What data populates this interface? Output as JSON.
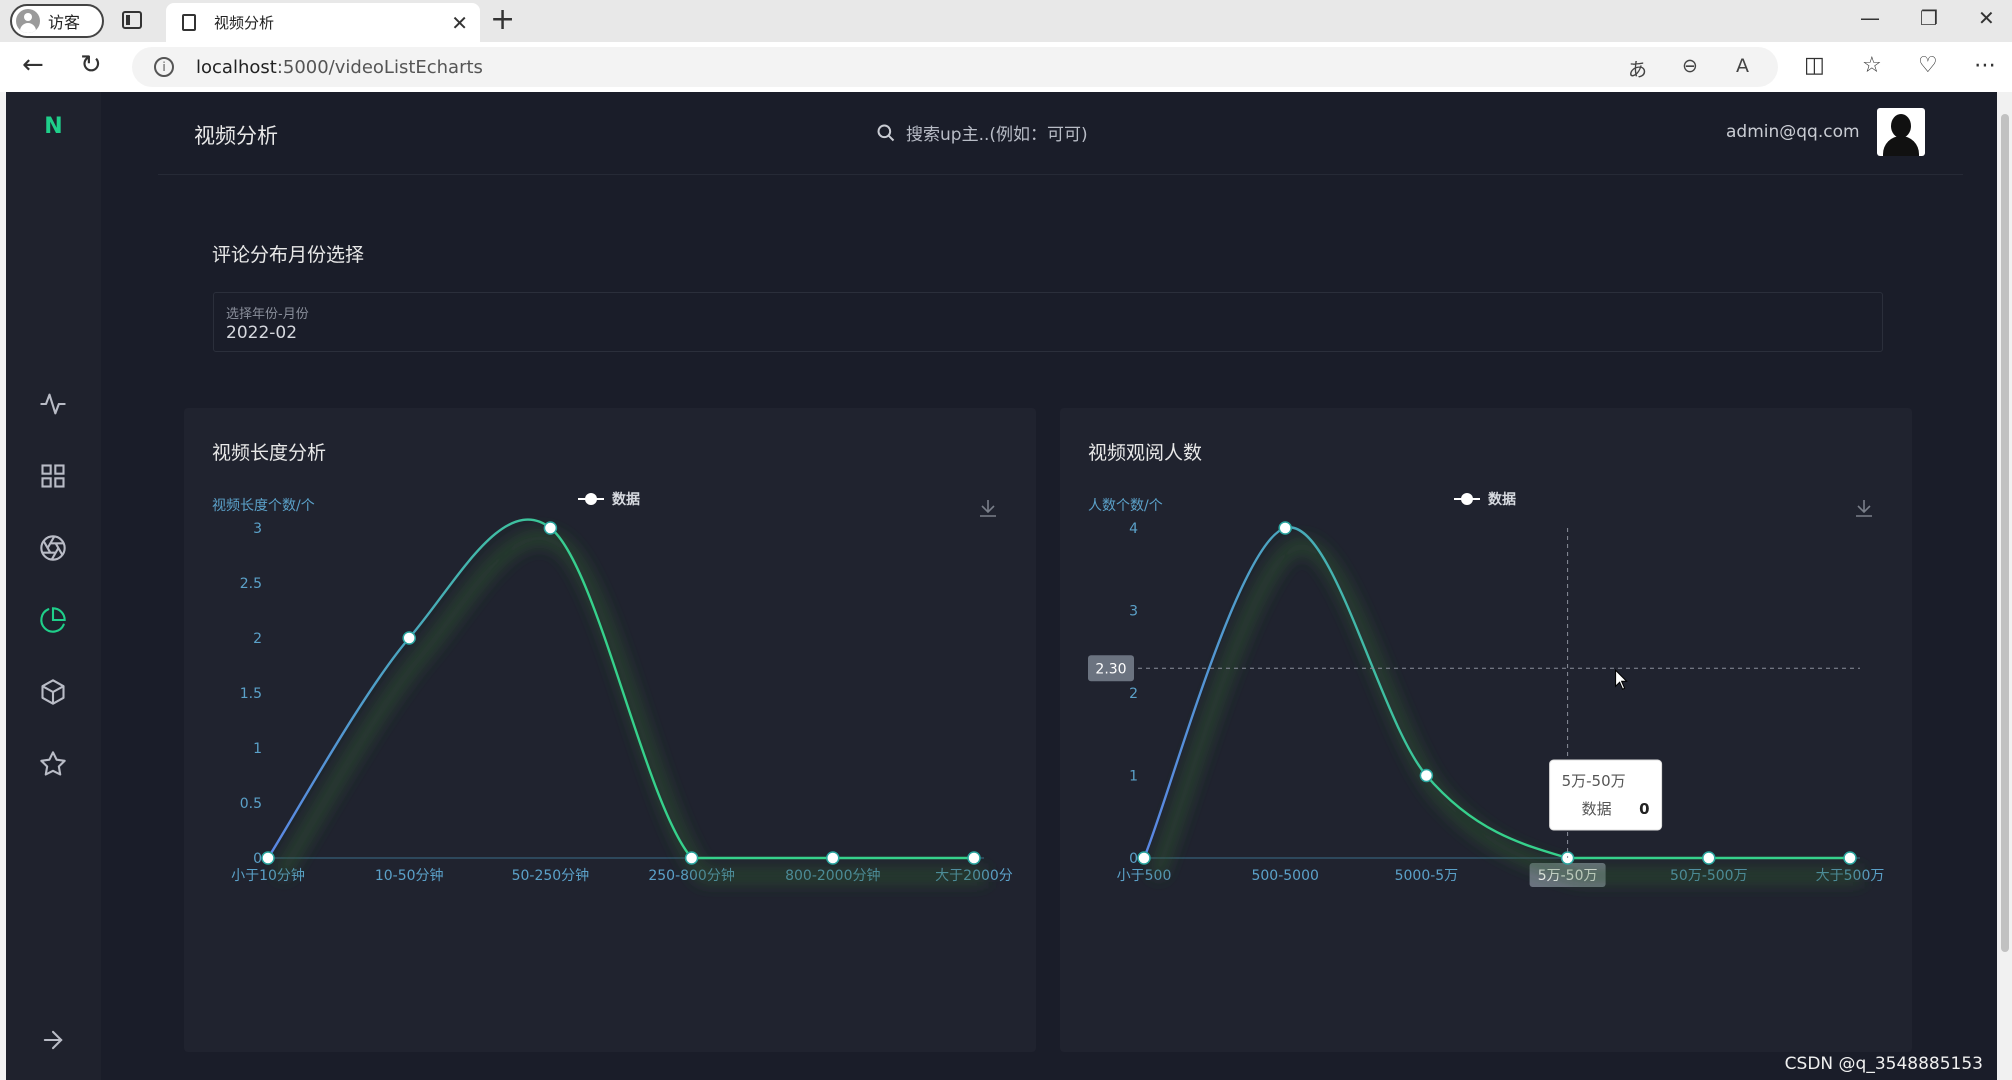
{
  "browser": {
    "profile_label": "访客",
    "tab_title": "视频分析",
    "url_host": "localhost",
    "url_rest": ":5000/videoListEcharts"
  },
  "app": {
    "logo": "N",
    "page_title": "视频分析",
    "search_placeholder": "搜索up主..(例如：可可)",
    "user_email": "admin@qq.com",
    "accent_color": "#1fcf8a"
  },
  "filter": {
    "section_title": "评论分布月份选择",
    "field_label": "选择年份-月份",
    "field_value": "2022-02"
  },
  "sidebar": {
    "items": [
      "pulse-icon",
      "grid-icon",
      "aperture-icon",
      "pie-chart-icon",
      "cube-icon",
      "star-icon"
    ],
    "active_index": 3,
    "footer_icon": "arrow-right-icon"
  },
  "chart_data": [
    {
      "type": "line",
      "smooth": true,
      "title": "视频长度分析",
      "ylabel": "视频长度个数/个",
      "legend": "数据",
      "legend_position": "top-center",
      "categories": [
        "小于10分钟",
        "10-50分钟",
        "50-250分钟",
        "250-800分钟",
        "800-2000分钟",
        "大于2000分"
      ],
      "series": [
        {
          "name": "数据",
          "values": [
            0,
            2,
            3,
            0,
            0,
            0
          ]
        }
      ],
      "yticks": [
        "0",
        "0.5",
        "1",
        "1.5",
        "2",
        "2.5",
        "3"
      ],
      "ylim": [
        0,
        3
      ],
      "line_gradient": [
        "#5b86e5",
        "#36d18c"
      ]
    },
    {
      "type": "line",
      "smooth": true,
      "title": "视频观阅人数",
      "ylabel": "人数个数/个",
      "legend": "数据",
      "legend_position": "top-center",
      "categories": [
        "小于500",
        "500-5000",
        "5000-5万",
        "5万-50万",
        "50万-500万",
        "大于500万"
      ],
      "series": [
        {
          "name": "数据",
          "values": [
            0,
            4,
            1,
            0,
            0,
            0
          ]
        }
      ],
      "yticks": [
        "0",
        "1",
        "2",
        "3",
        "4"
      ],
      "ylim": [
        0,
        4
      ],
      "line_gradient": [
        "#5b86e5",
        "#36d18c"
      ],
      "crosshair": {
        "y_label": "2.30",
        "x_label": "5万-50万",
        "y_value": 2.3,
        "x_index": 3
      },
      "tooltip": {
        "title": "5万-50万",
        "series": "数据",
        "value": "0"
      }
    }
  ],
  "watermark": "CSDN @q_3548885153"
}
